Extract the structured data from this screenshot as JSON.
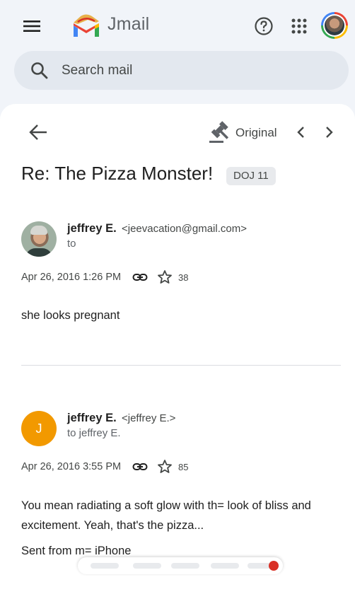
{
  "app": {
    "brand": "Jmail",
    "brand_color": "#5f6368",
    "accent": "#1a73e8"
  },
  "header": {
    "menu_icon": "menu-icon",
    "help_icon": "help-icon",
    "apps_icon": "apps-grid-icon"
  },
  "search": {
    "placeholder": "Search mail"
  },
  "toolbar": {
    "original_label": "Original"
  },
  "thread": {
    "subject": "Re: The Pizza Monster!",
    "label": "DOJ 11"
  },
  "messages": [
    {
      "sender": "jeffrey E.",
      "email": "<jeevacation@gmail.com>",
      "to": "to",
      "date": "Apr 26, 2016 1:26 PM",
      "star_count": "38",
      "body": [
        "she looks pregnant"
      ]
    },
    {
      "initial": "J",
      "avatar_color": "#f29900",
      "sender": "jeffrey E.",
      "email": "<jeffrey E.>",
      "to": "to jeffrey E.",
      "date": "Apr 26, 2016 3:55 PM",
      "star_count": "85",
      "body": [
        "You mean radiating a soft glow with th= look of bliss and",
        "excitement. Yeah, that's the pizza...",
        "Sent from m= iPhone"
      ]
    }
  ]
}
